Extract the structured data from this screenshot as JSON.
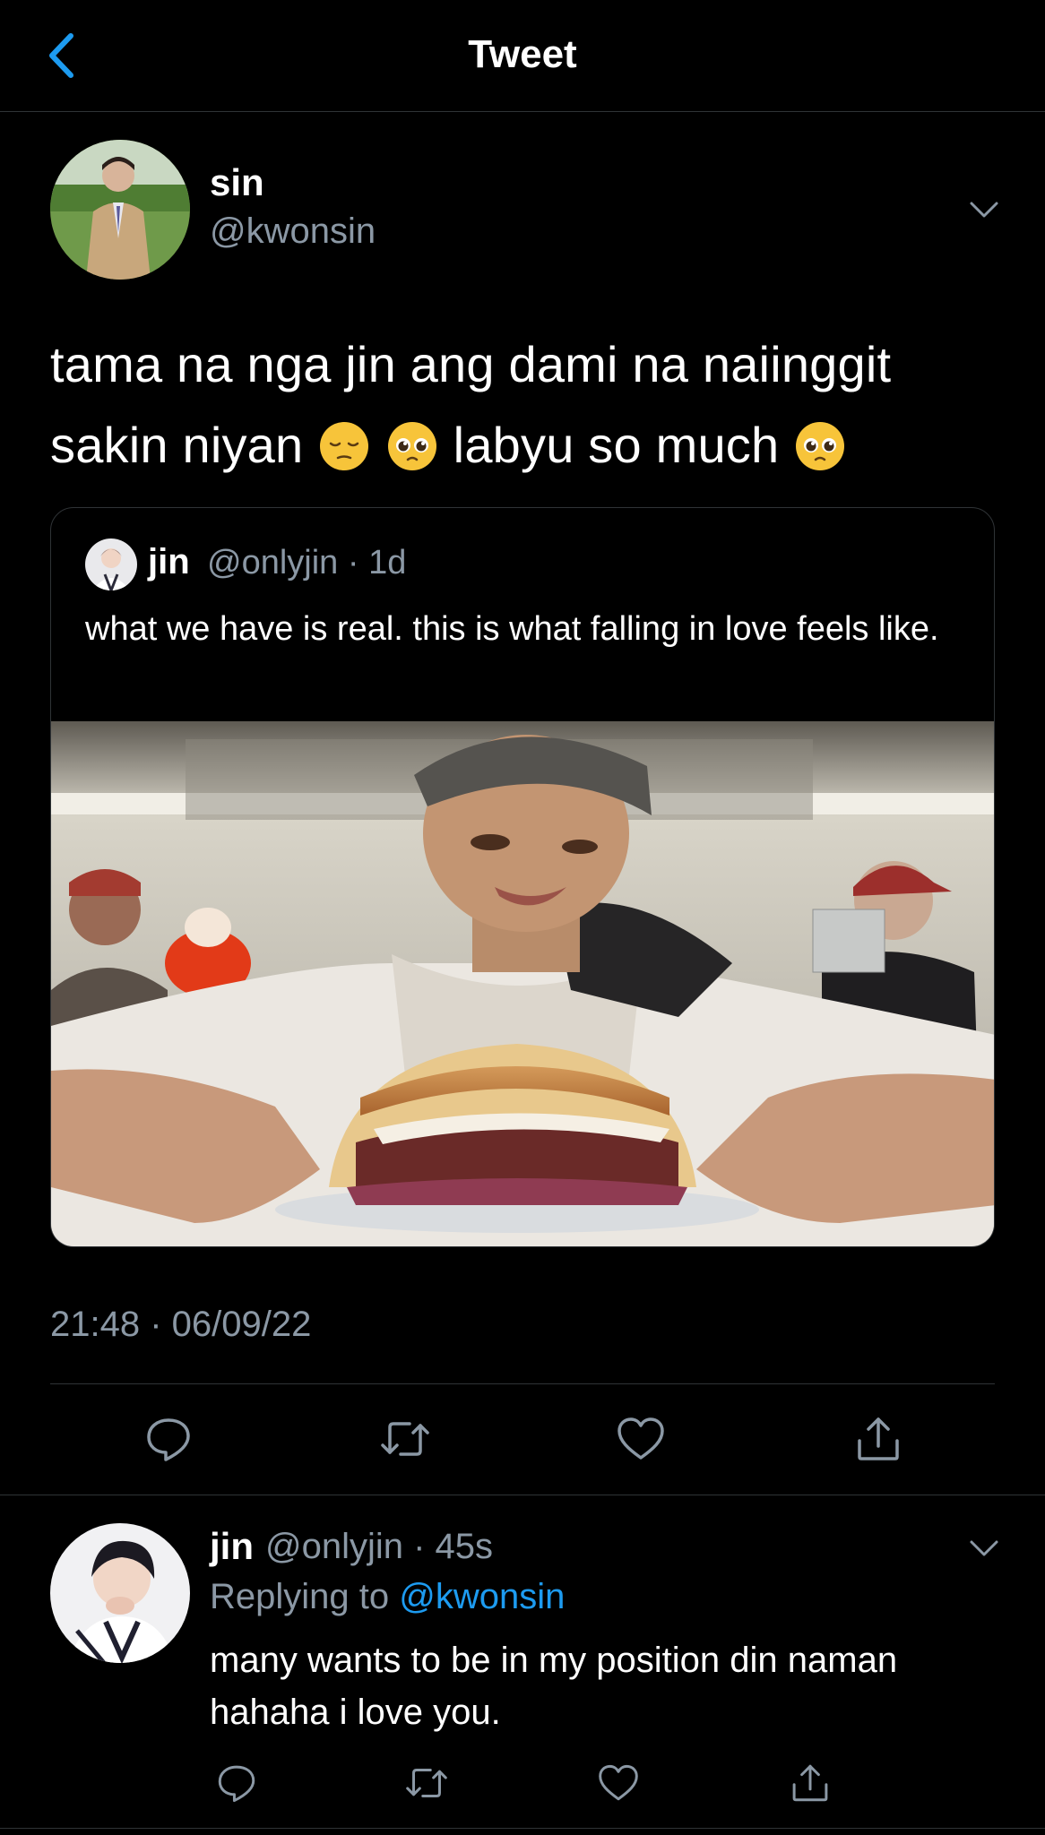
{
  "header": {
    "title": "Tweet",
    "back_icon": "chevron-left-icon"
  },
  "colors": {
    "background": "#000000",
    "accent": "#1d9bf0",
    "secondary_text": "#8b98a5",
    "divider": "#2f3336"
  },
  "tweet": {
    "author_name": "sin",
    "author_handle": "@kwonsin",
    "text_line1": "tama na nga jin ang dami na naiinggit",
    "text_line2_start": "sakin niyan",
    "text_line2_end": "labyu so much",
    "emojis": [
      "pensive-face-emoji",
      "pleading-face-emoji",
      "pleading-face-emoji"
    ],
    "timestamp": "21:48 · 06/09/22"
  },
  "quoted_tweet": {
    "author_name": "jin",
    "author_handle": "@onlyjin · 1d",
    "text": "what we have is real. this is what falling in love feels like."
  },
  "actions": [
    "reply-icon",
    "retweet-icon",
    "like-icon",
    "share-icon"
  ],
  "reply": {
    "author_name": "jin",
    "author_handle": "@onlyjin · 45s",
    "replying_prefix": "Replying to",
    "replying_handle": "@kwonsin",
    "text": "many wants to be in my position din naman hahaha i love you."
  }
}
